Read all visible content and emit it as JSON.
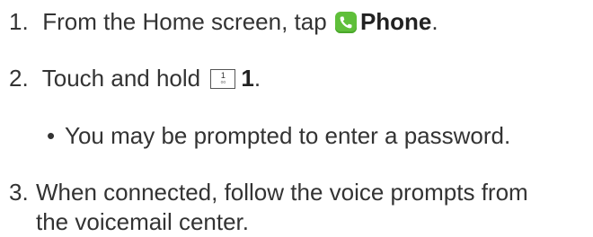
{
  "steps": [
    {
      "number": "1.",
      "text_before": "From the Home screen, tap",
      "icon": "phone-icon",
      "bold": "Phone",
      "text_after": "."
    },
    {
      "number": "2.",
      "text_before": "Touch and hold",
      "key_digit": "1",
      "key_sub": "oo",
      "bold": "1",
      "text_after": "."
    },
    {
      "number": "3.",
      "line1": "When connected, follow the voice prompts from",
      "line2": "the voicemail center."
    }
  ],
  "bullet": {
    "marker": "•",
    "text": "You may be prompted to enter a password."
  },
  "colors": {
    "text": "#333333",
    "phone_icon_bg": "#5fbf3a"
  }
}
